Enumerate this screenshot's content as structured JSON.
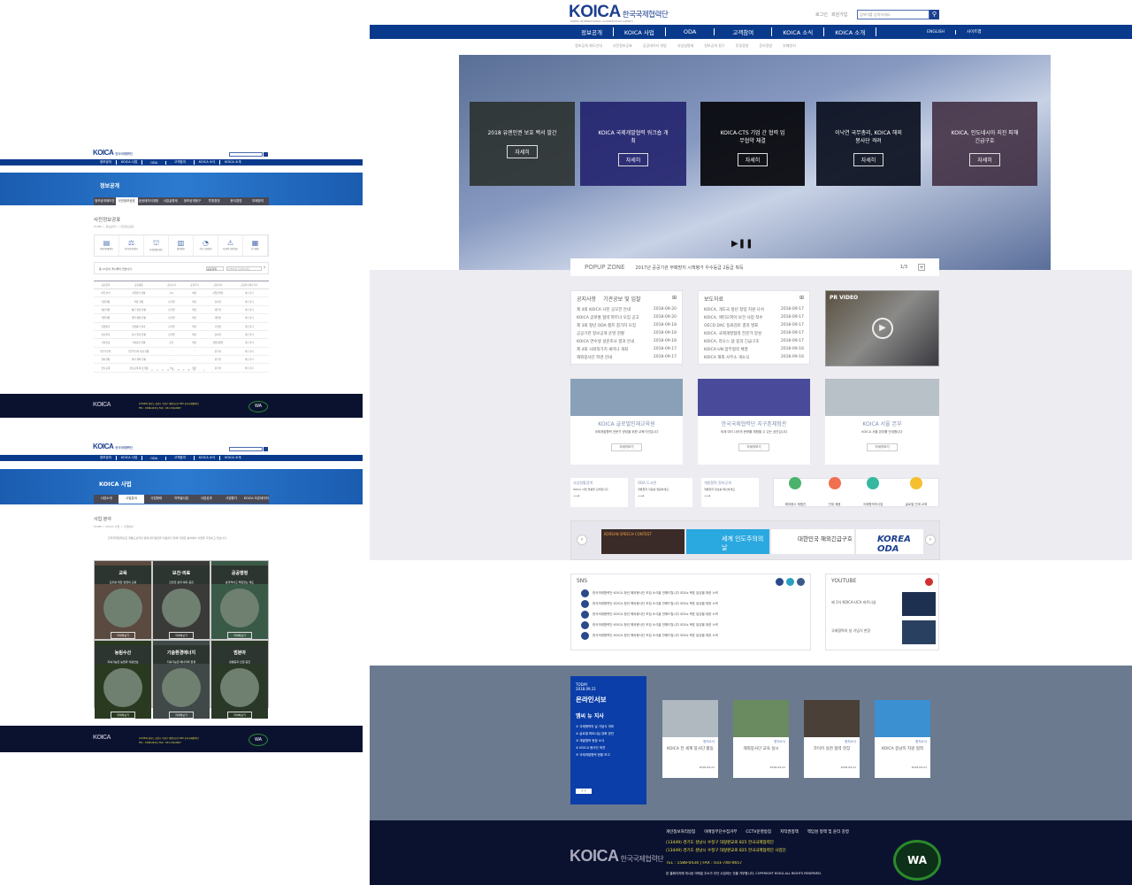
{
  "main": {
    "logo": "KOICA",
    "logo_kr": "한국국제협력단",
    "logo_sub": "KOREA INTERNATIONAL COOPERATION AGENCY",
    "util": [
      "로그인",
      "회원가입"
    ],
    "search_placeholder": "검색어를 입력하세요",
    "nav": [
      "정보공개",
      "KOICA 사업",
      "ODA",
      "고객참여",
      "KOICA 소식",
      "KOICA 소개"
    ],
    "nav_right": [
      "ENGLISH",
      "사이트맵"
    ],
    "subnav": [
      "정보공개 제도안내",
      "사전정보공표",
      "공공데이터 개방",
      "사업실명제",
      "정보공개 청구",
      "투명경영",
      "윤리경영",
      "부패방지"
    ],
    "hero_cards": [
      {
        "text": "2018 유엔인권 보호 백서 발간",
        "btn": "자세히"
      },
      {
        "text": "KOICA 국제개발협력 워크숍 개최",
        "btn": "자세히"
      },
      {
        "text": "KOICA-CTS 기업 간 협력 업무협약 체결",
        "btn": "자세히"
      },
      {
        "text": "이낙연 국무총리, KOICA 해외봉사단 격려",
        "btn": "자세히"
      },
      {
        "text": "KOICA, 인도네시아 지진 피해 긴급구호",
        "btn": "자세히"
      }
    ],
    "popup": {
      "label": "POPUP ZONE",
      "text": "2017년 공공기관 부패방지 시책평가 우수등급 2등급 획득",
      "count": "1/3"
    },
    "notice": {
      "tabs": [
        "공지사항",
        "기관공보 및 입찰"
      ],
      "items": [
        [
          "제 4회 KOICA 사진 공모전 안내",
          "2018-09-20"
        ],
        [
          "KOICA 글로벌 협력 파트너 모집 공고",
          "2018-09-20"
        ],
        [
          "제 3회 청년 ODA 캠프 참가자 모집",
          "2018-09-18"
        ],
        [
          "공공기관 정보공개 운영 현황",
          "2018-09-18"
        ],
        [
          "KOICA 연수생 설문조사 결과 안내",
          "2018-09-18"
        ],
        [
          "제 4회 사회적가치 세미나 개최",
          "2018-09-17"
        ],
        [
          "해외봉사단 파견 안내",
          "2018-09-17"
        ]
      ]
    },
    "press": {
      "title": "보도자료",
      "items": [
        [
          "KOICA, 개도국 청년 창업 지원 나서",
          "2018-09-17"
        ],
        [
          "KOICA, 에티오피아 보건 사업 착수",
          "2018-09-17"
        ],
        [
          "OECD DAC 동료검토 결과 발표",
          "2018-09-17"
        ],
        [
          "KOICA, 국제개발협력 전문가 양성",
          "2018-09-17"
        ],
        [
          "KOICA, 라오스 댐 붕괴 긴급구호",
          "2018-09-17"
        ],
        [
          "KOICA-UN 업무협약 체결",
          "2018-09-16"
        ],
        [
          "KOICA 해외 사무소 개소식",
          "2018-09-16"
        ]
      ]
    },
    "pr_video": "PR VIDEO",
    "feature_cards": [
      {
        "title": "KOICA 글로벌인재교육원",
        "desc": "국제개발협력 전문가 양성을 위한 교육기관입니다",
        "btn": "자세히보기"
      },
      {
        "title": "한국국제협력단 지구촌체험관",
        "desc": "세계 여러 나라의 문화를 체험할 수 있는 공간입니다",
        "btn": "자세히보기"
      },
      {
        "title": "KOICA 서울 본부",
        "desc": "KOICA 서울 본부를 안내합니다",
        "btn": "자세히보기"
      }
    ],
    "quick": [
      {
        "title": "사업현황검색",
        "desc": "KOICA 사업 현황을 검색합니다"
      },
      {
        "title": "ODA 도서관",
        "desc": "개발협력 자료를 열람하세요"
      },
      {
        "title": "개발협력 정보공개",
        "desc": "개발협력 정보를 확인하세요"
      }
    ],
    "quick_icons": [
      "해외봉사 체험관",
      "인재 채용",
      "국제협력의사업",
      "글로벌 인재 교육"
    ],
    "banners": [
      "KOREAN SPEECH CONTEST",
      "세계 인도주의의 날",
      "대한민국 해외긴급구호",
      "KOREA ODA"
    ],
    "sns": {
      "title": "SNS",
      "items": [
        "한국국제협력단 KOICA 청년 해외봉사단 모집 소식을 전해드립니다 SDGs 목표 달성을 위한 노력",
        "한국국제협력단 KOICA 청년 해외봉사단 모집 소식을 전해드립니다 SDGs 목표 달성을 위한 노력",
        "한국국제협력단 KOICA 청년 해외봉사단 모집 소식을 전해드립니다 SDGs 목표 달성을 위한 노력",
        "한국국제협력단 KOICA 청년 해외봉사단 모집 소식을 전해드립니다 SDGs 목표 달성을 위한 노력",
        "한국국제협력단 KOICA 청년 해외봉사단 모집 소식을 전해드립니다 SDGs 목표 달성을 위한 노력"
      ]
    },
    "youtube": {
      "title": "YOUTUBE",
      "items": [
        "제 1차 KOICA-UCA 파트너십",
        "국제협력의 날 기념식 현장"
      ]
    },
    "online": {
      "date1": "TODAY",
      "date2": "2018.09.21",
      "title": "온라인서보",
      "sub": "엠씨 뉴 지사",
      "items": [
        "① 국제협력의 날 기념식 개최",
        "② 글로벌 파트너십 강화 방안",
        "③ 개발협력 현장 소식",
        "④ KOICA 봉사단 파견",
        "⑤ 국제개발협력 현황 보고"
      ]
    },
    "news": [
      {
        "cat": "현지소식",
        "title": "KOICA 전 세계 봉사단 활동",
        "date": "2018-09-21"
      },
      {
        "cat": "현지소식",
        "title": "해외봉사단 교육 실시",
        "date": "2018-09-21"
      },
      {
        "cat": "현지소식",
        "title": "코이카 실천 협력 현장",
        "date": "2018-09-21"
      },
      {
        "cat": "현지소식",
        "title": "KOICA 중남미 지원 협력",
        "date": "2018-09-21"
      }
    ],
    "footer": {
      "links": [
        "개인정보처리방침",
        "이메일무단수집거부",
        "CCTV운영방침",
        "저작권정책",
        "책임성 정책 및 윤리 강령"
      ],
      "addr1": "(13449) 경기도 성남시 수정구 대왕판교로 825 한국국제협력단",
      "addr2": "(13449) 경기도 성남시 수정구 대왕판교로 825 한국국제협력단 사업단",
      "tel": "TEL : 1588-0434 | FAX : 031-740-0657",
      "copy": "본 홈페이지에 게시된 이메일 주소가 무단 수집되는 것을 거부합니다. COPYRIGHT KOICA ALL RIGHTS RESERVED.",
      "badge": "WA"
    }
  },
  "page1": {
    "title": "정보공개",
    "tabs": [
      "정보공개제도안내",
      "사전정보공표",
      "공공데이터개방",
      "사업실명제",
      "정보공개청구",
      "투명경영",
      "윤리경영",
      "부패방지"
    ],
    "heading": "사전정보공표",
    "breadcrumb": "HOME > 정보공개 > 사전정보공표",
    "icons": [
      "재무/회계정보",
      "인사/조직정보",
      "사업/예산정보",
      "경영정보",
      "기타 공표정보",
      "사회적 가치정보",
      "공시정보"
    ],
    "search_info": "총 10건의 게시물이 있습니다",
    "search_select": "공표항목",
    "search_placeholder": "검색어를 입력하세요",
    "columns": [
      "공표항목",
      "공표내용",
      "공표시기",
      "공표주기",
      "공표부서",
      "공표자료바로가기"
    ],
    "rows": [
      [
        "사업 실적",
        "사업실적 현황",
        "수시",
        "매년",
        "사업전략실",
        "바로가기"
      ],
      [
        "직원현황",
        "직원 현황",
        "분기별",
        "매년",
        "인사실",
        "바로가기"
      ],
      [
        "예산현황",
        "예산 편성 현황",
        "분기별",
        "매년",
        "재무실",
        "바로가기"
      ],
      [
        "계약현황",
        "계약 체결 현황",
        "분기별",
        "매년",
        "계약실",
        "바로가기"
      ],
      [
        "경영평가",
        "경영평가 결과",
        "분기별",
        "매년",
        "기획실",
        "바로가기"
      ],
      [
        "감사결과",
        "감사 결과 현황",
        "분기별",
        "매년",
        "감사실",
        "바로가기"
      ],
      [
        "국외출장",
        "국외출장 현황",
        "분기",
        "매년",
        "경영지원실",
        "바로가기"
      ],
      [
        "업무추진비",
        "업무추진비 사용 현황",
        "-",
        "-",
        "총무실",
        "바로가기"
      ],
      [
        "행사현황",
        "행사 개최 현황",
        "-",
        "-",
        "총무실",
        "바로가기"
      ],
      [
        "정보공개",
        "정보공개 처리 현황",
        "수시",
        "매년",
        "총무실",
        "바로가기"
      ]
    ],
    "pages": [
      "«",
      "‹",
      "1",
      "2",
      "3",
      "4",
      "5",
      "6",
      "7",
      "8",
      "9",
      "›",
      "»"
    ]
  },
  "page2": {
    "title": "KOICA 사업",
    "tabs": [
      "사업소개",
      "사업분야",
      "사업형태",
      "지역별사업",
      "사업성과",
      "사업평가",
      "KOICA 오픈데이터"
    ],
    "heading": "사업 분야",
    "breadcrumb": "HOME > KOICA 사업 > 사업분야",
    "intro": "한국국제협력단은 개발도상국의 경제사회 발전을 지원하기 위해 다양한 분야에서 사업을 추진하고 있습니다.",
    "fields": [
      {
        "name": "교육",
        "desc": "모두를 위한 양질의 교육",
        "btn": "자세히보기"
      },
      {
        "name": "보건·의료",
        "desc": "건강한 삶과 복지 증진",
        "btn": "자세히보기"
      },
      {
        "name": "공공행정",
        "desc": "효과적이고 책임있는 제도",
        "btn": "자세히보기"
      },
      {
        "name": "농림수산",
        "desc": "지속가능한 농업과 식량안보",
        "btn": "자세히보기"
      },
      {
        "name": "기술환경에너지",
        "desc": "지속가능한 에너지와 환경",
        "btn": "자세히보기"
      },
      {
        "name": "범분야",
        "desc": "성평등과 인권 증진",
        "btn": "자세히보기"
      }
    ]
  },
  "colors": {
    "nav": "#0a3a8c",
    "footer": "#0b1230",
    "slate": "#6b7a8f",
    "gray_bg": "#ececf1",
    "accent_blue": "#0b3ea8"
  }
}
